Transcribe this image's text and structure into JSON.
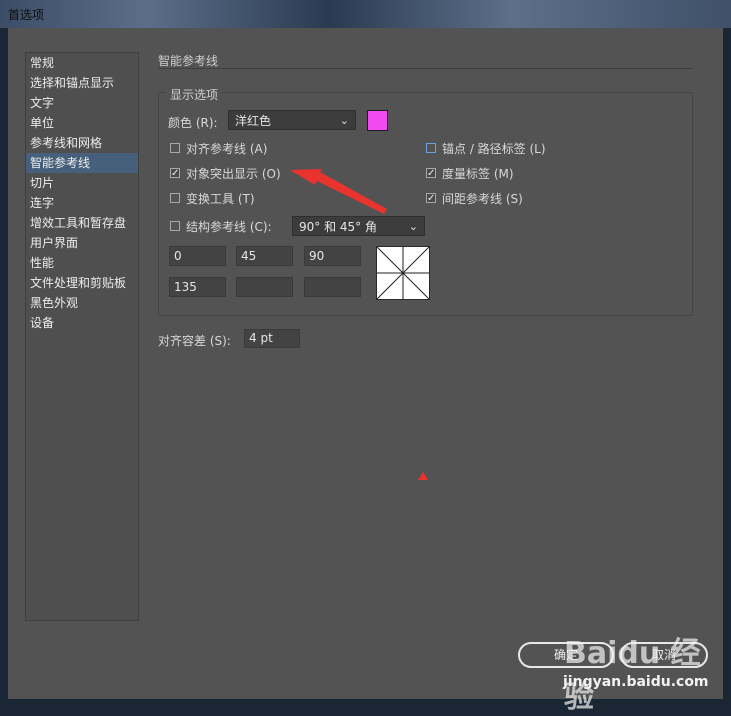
{
  "window": {
    "title": "首选项"
  },
  "sidebar": {
    "items": [
      {
        "label": "常规"
      },
      {
        "label": "选择和锚点显示"
      },
      {
        "label": "文字"
      },
      {
        "label": "单位"
      },
      {
        "label": "参考线和网格"
      },
      {
        "label": "智能参考线",
        "active": true
      },
      {
        "label": "切片"
      },
      {
        "label": "连字"
      },
      {
        "label": "增效工具和暂存盘"
      },
      {
        "label": "用户界面"
      },
      {
        "label": "性能"
      },
      {
        "label": "文件处理和剪贴板"
      },
      {
        "label": "黑色外观"
      },
      {
        "label": "设备"
      }
    ]
  },
  "panel": {
    "section_title": "智能参考线",
    "group_title": "显示选项",
    "color_label": "颜色 (R):",
    "color_value": "洋红色",
    "color_swatch": "#f24af2",
    "checkboxes": {
      "align_guides": {
        "label": "对齐参考线 (A)",
        "checked": false
      },
      "object_highlight": {
        "label": "对象突出显示 (O)",
        "checked": true
      },
      "transform_tools": {
        "label": "变换工具 (T)",
        "checked": false
      },
      "anchor_labels": {
        "label": "锚点 / 路径标签 (L)",
        "checked": false
      },
      "measure_labels": {
        "label": "度量标签 (M)",
        "checked": true
      },
      "spacing_guides": {
        "label": "间距参考线 (S)",
        "checked": true
      },
      "construction_guides": {
        "label": "结构参考线 (C):",
        "checked": false
      }
    },
    "construction_angle_value": "90° 和 45° 角",
    "angles": [
      "0",
      "45",
      "90",
      "135",
      "",
      ""
    ],
    "snap_tolerance_label": "对齐容差 (S):",
    "snap_tolerance_value": "4 pt"
  },
  "buttons": {
    "ok": "确定",
    "cancel": "取消"
  },
  "watermark": {
    "brand": "Baidu 经验",
    "site": "jingyan.baidu.com"
  },
  "annotation_color": "#e8332e"
}
